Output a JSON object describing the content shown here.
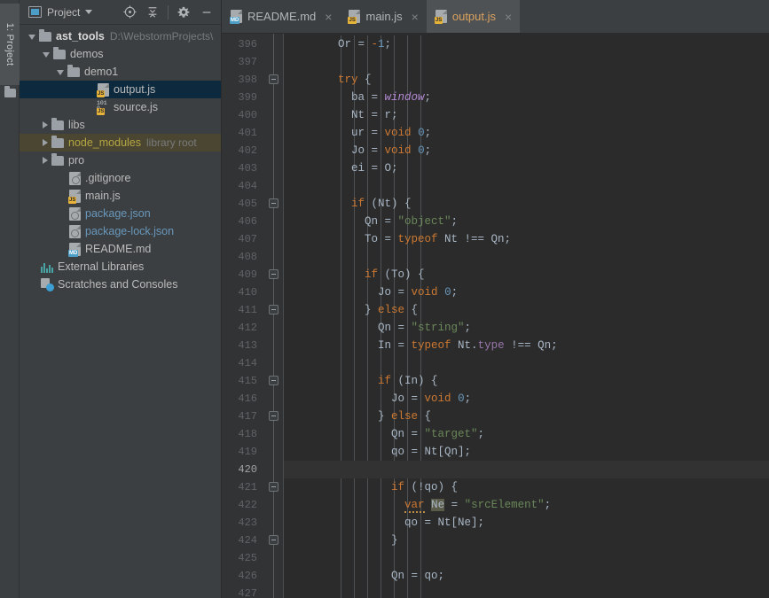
{
  "window": {
    "tool_tab_label": "1: Project",
    "tool_tab_icon": "folder-icon"
  },
  "project_panel": {
    "title": "Project",
    "title_icon": "project-view-icon",
    "dropdown_icon": "chevron-down-icon",
    "toolbar_buttons": [
      {
        "name": "locate-icon",
        "glyph": "⊕"
      },
      {
        "name": "collapse-all-icon",
        "glyph": "↓"
      },
      {
        "name": "settings-gear-icon",
        "glyph": "⚙"
      },
      {
        "name": "hide-icon",
        "glyph": "—"
      }
    ],
    "tree": [
      {
        "label": "ast_tools",
        "suffix": "D:\\WebstormProjects\\",
        "icon": "folder-icon",
        "indent": 1,
        "state": "expanded",
        "style": "root",
        "selected": false
      },
      {
        "label": "demos",
        "suffix": "",
        "icon": "folder-icon",
        "indent": 2,
        "state": "expanded",
        "style": "plain",
        "selected": false
      },
      {
        "label": "demo1",
        "suffix": "",
        "icon": "folder-icon",
        "indent": 3,
        "state": "expanded",
        "style": "plain",
        "selected": false
      },
      {
        "label": "output.js",
        "suffix": "",
        "icon": "js-file-icon",
        "indent": 5,
        "state": "leaf",
        "style": "plain",
        "selected": true
      },
      {
        "label": "source.js",
        "suffix": "",
        "icon": "js-binary-file-icon",
        "indent": 5,
        "state": "leaf",
        "style": "plain",
        "selected": false
      },
      {
        "label": "libs",
        "suffix": "",
        "icon": "folder-icon",
        "indent": 2,
        "state": "collapsed",
        "style": "plain",
        "selected": false
      },
      {
        "label": "node_modules",
        "suffix": "library root",
        "icon": "folder-icon",
        "indent": 2,
        "state": "collapsed",
        "style": "library-root",
        "selected": false
      },
      {
        "label": "pro",
        "suffix": "",
        "icon": "folder-icon",
        "indent": 2,
        "state": "collapsed",
        "style": "plain",
        "selected": false
      },
      {
        "label": ".gitignore",
        "suffix": "",
        "icon": "gitignore-file-icon",
        "indent": 3,
        "state": "leaf",
        "style": "plain",
        "selected": false
      },
      {
        "label": "main.js",
        "suffix": "",
        "icon": "js-file-icon",
        "indent": 3,
        "state": "leaf",
        "style": "plain",
        "selected": false
      },
      {
        "label": "package.json",
        "suffix": "",
        "icon": "json-file-icon",
        "indent": 3,
        "state": "leaf",
        "style": "json",
        "selected": false
      },
      {
        "label": "package-lock.json",
        "suffix": "",
        "icon": "json-file-icon",
        "indent": 3,
        "state": "leaf",
        "style": "json",
        "selected": false
      },
      {
        "label": "README.md",
        "suffix": "",
        "icon": "md-file-icon",
        "indent": 3,
        "state": "leaf",
        "style": "plain",
        "selected": false
      },
      {
        "label": "External Libraries",
        "suffix": "",
        "icon": "external-libraries-icon",
        "indent": 1,
        "state": "leaf",
        "style": "plain",
        "selected": false
      },
      {
        "label": "Scratches and Consoles",
        "suffix": "",
        "icon": "scratches-icon",
        "indent": 1,
        "state": "leaf",
        "style": "plain",
        "selected": false
      }
    ]
  },
  "editor": {
    "tabs": [
      {
        "label": "README.md",
        "icon": "md-file-icon",
        "badge": "MD",
        "active": false,
        "close_glyph": "×"
      },
      {
        "label": "main.js",
        "icon": "js-file-icon",
        "badge": "JS",
        "active": false,
        "close_glyph": "×"
      },
      {
        "label": "output.js",
        "icon": "js-file-icon",
        "badge": "JS",
        "active": true,
        "close_glyph": "×"
      }
    ],
    "first_line_number": 396,
    "caret_line_number": 420,
    "lines": [
      {
        "n": 396,
        "fold": "",
        "tokens": [
          {
            "t": "      Or = ",
            "c": ""
          },
          {
            "t": "-",
            "c": "kw"
          },
          {
            "t": "1",
            "c": "num"
          },
          {
            "t": ";",
            "c": ""
          }
        ]
      },
      {
        "n": 397,
        "fold": "",
        "tokens": []
      },
      {
        "n": 398,
        "fold": "start",
        "tokens": [
          {
            "t": "      ",
            "c": ""
          },
          {
            "t": "try",
            "c": "kw"
          },
          {
            "t": " {",
            "c": ""
          }
        ]
      },
      {
        "n": 399,
        "fold": "",
        "tokens": [
          {
            "t": "        ba = ",
            "c": ""
          },
          {
            "t": "window",
            "c": "gbl"
          },
          {
            "t": ";",
            "c": ""
          }
        ]
      },
      {
        "n": 400,
        "fold": "",
        "tokens": [
          {
            "t": "        Nt = r;",
            "c": ""
          }
        ]
      },
      {
        "n": 401,
        "fold": "",
        "tokens": [
          {
            "t": "        ur = ",
            "c": ""
          },
          {
            "t": "void",
            "c": "kw"
          },
          {
            "t": " ",
            "c": ""
          },
          {
            "t": "0",
            "c": "num"
          },
          {
            "t": ";",
            "c": ""
          }
        ]
      },
      {
        "n": 402,
        "fold": "",
        "tokens": [
          {
            "t": "        Jo = ",
            "c": ""
          },
          {
            "t": "void",
            "c": "kw"
          },
          {
            "t": " ",
            "c": ""
          },
          {
            "t": "0",
            "c": "num"
          },
          {
            "t": ";",
            "c": ""
          }
        ]
      },
      {
        "n": 403,
        "fold": "",
        "tokens": [
          {
            "t": "        ei = O;",
            "c": ""
          }
        ]
      },
      {
        "n": 404,
        "fold": "",
        "tokens": []
      },
      {
        "n": 405,
        "fold": "start",
        "tokens": [
          {
            "t": "        ",
            "c": ""
          },
          {
            "t": "if",
            "c": "kw"
          },
          {
            "t": " (Nt) {",
            "c": ""
          }
        ]
      },
      {
        "n": 406,
        "fold": "",
        "tokens": [
          {
            "t": "          Qn = ",
            "c": ""
          },
          {
            "t": "\"object\"",
            "c": "str"
          },
          {
            "t": ";",
            "c": ""
          }
        ]
      },
      {
        "n": 407,
        "fold": "",
        "tokens": [
          {
            "t": "          To = ",
            "c": ""
          },
          {
            "t": "typeof",
            "c": "kw"
          },
          {
            "t": " Nt !== Qn;",
            "c": ""
          }
        ]
      },
      {
        "n": 408,
        "fold": "",
        "tokens": []
      },
      {
        "n": 409,
        "fold": "start",
        "tokens": [
          {
            "t": "          ",
            "c": ""
          },
          {
            "t": "if",
            "c": "kw"
          },
          {
            "t": " (To) {",
            "c": ""
          }
        ]
      },
      {
        "n": 410,
        "fold": "",
        "tokens": [
          {
            "t": "            Jo = ",
            "c": ""
          },
          {
            "t": "void",
            "c": "kw"
          },
          {
            "t": " ",
            "c": ""
          },
          {
            "t": "0",
            "c": "num"
          },
          {
            "t": ";",
            "c": ""
          }
        ]
      },
      {
        "n": 411,
        "fold": "end",
        "tokens": [
          {
            "t": "          } ",
            "c": ""
          },
          {
            "t": "else",
            "c": "kw"
          },
          {
            "t": " {",
            "c": ""
          }
        ]
      },
      {
        "n": 412,
        "fold": "",
        "tokens": [
          {
            "t": "            Qn = ",
            "c": ""
          },
          {
            "t": "\"string\"",
            "c": "str"
          },
          {
            "t": ";",
            "c": ""
          }
        ]
      },
      {
        "n": 413,
        "fold": "",
        "tokens": [
          {
            "t": "            In = ",
            "c": ""
          },
          {
            "t": "typeof",
            "c": "kw"
          },
          {
            "t": " Nt.",
            "c": ""
          },
          {
            "t": "type",
            "c": "prop"
          },
          {
            "t": " !== Qn;",
            "c": ""
          }
        ]
      },
      {
        "n": 414,
        "fold": "",
        "tokens": []
      },
      {
        "n": 415,
        "fold": "start",
        "tokens": [
          {
            "t": "            ",
            "c": ""
          },
          {
            "t": "if",
            "c": "kw"
          },
          {
            "t": " (In) {",
            "c": ""
          }
        ]
      },
      {
        "n": 416,
        "fold": "",
        "tokens": [
          {
            "t": "              Jo = ",
            "c": ""
          },
          {
            "t": "void",
            "c": "kw"
          },
          {
            "t": " ",
            "c": ""
          },
          {
            "t": "0",
            "c": "num"
          },
          {
            "t": ";",
            "c": ""
          }
        ]
      },
      {
        "n": 417,
        "fold": "end",
        "tokens": [
          {
            "t": "            } ",
            "c": ""
          },
          {
            "t": "else",
            "c": "kw"
          },
          {
            "t": " {",
            "c": ""
          }
        ]
      },
      {
        "n": 418,
        "fold": "",
        "tokens": [
          {
            "t": "              Qn = ",
            "c": ""
          },
          {
            "t": "\"target\"",
            "c": "str"
          },
          {
            "t": ";",
            "c": ""
          }
        ]
      },
      {
        "n": 419,
        "fold": "",
        "tokens": [
          {
            "t": "              qo = Nt[Qn];",
            "c": ""
          }
        ]
      },
      {
        "n": 420,
        "fold": "",
        "tokens": []
      },
      {
        "n": 421,
        "fold": "start",
        "tokens": [
          {
            "t": "              ",
            "c": ""
          },
          {
            "t": "if",
            "c": "kw"
          },
          {
            "t": " (!qo) {",
            "c": ""
          }
        ]
      },
      {
        "n": 422,
        "fold": "",
        "tokens": [
          {
            "t": "                ",
            "c": ""
          },
          {
            "t": "var",
            "c": "warnvar"
          },
          {
            "t": " ",
            "c": ""
          },
          {
            "t": "Ne",
            "c": "idhl"
          },
          {
            "t": " = ",
            "c": ""
          },
          {
            "t": "\"srcElement\"",
            "c": "str"
          },
          {
            "t": ";",
            "c": ""
          }
        ]
      },
      {
        "n": 423,
        "fold": "",
        "tokens": [
          {
            "t": "                qo = Nt[Ne];",
            "c": ""
          }
        ]
      },
      {
        "n": 424,
        "fold": "end",
        "tokens": [
          {
            "t": "              }",
            "c": ""
          }
        ]
      },
      {
        "n": 425,
        "fold": "",
        "tokens": []
      },
      {
        "n": 426,
        "fold": "",
        "tokens": [
          {
            "t": "              Qn = qo;",
            "c": ""
          }
        ]
      },
      {
        "n": 427,
        "fold": "",
        "tokens": []
      }
    ]
  },
  "colors": {
    "panel_bg": "#3c3f41",
    "editor_bg": "#2b2b2b",
    "gutter_bg": "#313335",
    "selection_blue": "#0d293e",
    "library_root": "#4b4632",
    "active_tab_text": "#d9a25f",
    "keyword": "#cc7832",
    "string": "#6a8759",
    "number": "#6897bb",
    "property": "#9876aa",
    "global": "#b389d4",
    "default_text": "#a9b7c6"
  }
}
